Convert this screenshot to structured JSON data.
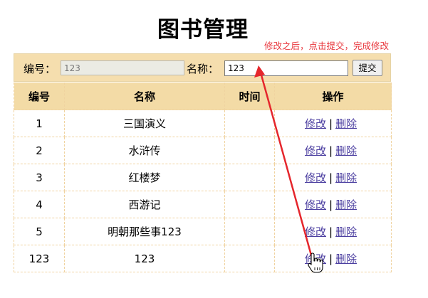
{
  "page": {
    "title": "图书管理",
    "annotation": "修改之后，点击提交，完成修改"
  },
  "form": {
    "id_label": "编号：",
    "id_value": "123",
    "name_label": "名称：",
    "name_value": "123",
    "submit_label": "提交"
  },
  "table": {
    "headers": [
      "编号",
      "名称",
      "时间",
      "操作"
    ],
    "rows": [
      {
        "id": "1",
        "name": "三国演义",
        "time": "",
        "edit": "修改",
        "sep": "|",
        "delete": "删除"
      },
      {
        "id": "2",
        "name": "水浒传",
        "time": "",
        "edit": "修改",
        "sep": "|",
        "delete": "删除"
      },
      {
        "id": "3",
        "name": "红楼梦",
        "time": "",
        "edit": "修改",
        "sep": "|",
        "delete": "删除"
      },
      {
        "id": "4",
        "name": "西游记",
        "time": "",
        "edit": "修改",
        "sep": "|",
        "delete": "删除"
      },
      {
        "id": "5",
        "name": "明朝那些事123",
        "time": "",
        "edit": "修改",
        "sep": "|",
        "delete": "删除"
      },
      {
        "id": "123",
        "name": "123",
        "time": "",
        "edit": "修改",
        "sep": "|",
        "delete": "删除"
      }
    ]
  },
  "colors": {
    "header_bg": "#f3dba6",
    "annotation": "#e8343a",
    "link": "#4b3ea0"
  },
  "icons": [
    "hand-cursor-icon",
    "red-arrow-icon"
  ]
}
